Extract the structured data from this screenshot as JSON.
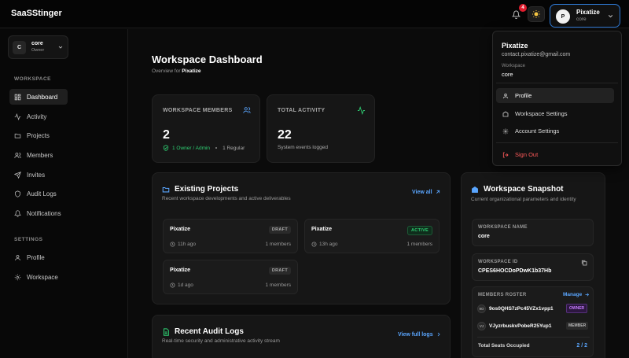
{
  "topbar": {
    "brand": "SaaSStinger",
    "notif_count": "4"
  },
  "user": {
    "name": "Pixatize",
    "workspace": "core",
    "avatar_initial": "P"
  },
  "sidebar": {
    "workspace": {
      "initial": "C",
      "name": "core",
      "role": "Owner"
    },
    "section_workspace": "WORKSPACE",
    "section_settings": "SETTINGS",
    "workspace_items": [
      {
        "label": "Dashboard",
        "icon": "dashboard-icon"
      },
      {
        "label": "Activity",
        "icon": "activity-icon"
      },
      {
        "label": "Projects",
        "icon": "folder-icon"
      },
      {
        "label": "Members",
        "icon": "users-icon"
      },
      {
        "label": "Invites",
        "icon": "invite-icon"
      },
      {
        "label": "Audit Logs",
        "icon": "shield-icon"
      },
      {
        "label": "Notifications",
        "icon": "bell-icon"
      }
    ],
    "settings_items": [
      {
        "label": "Profile",
        "icon": "user-icon"
      },
      {
        "label": "Workspace",
        "icon": "gear-icon"
      }
    ]
  },
  "main": {
    "title": "Workspace Dashboard",
    "subtitle_prefix": "Overview for",
    "subtitle_name": "Pixatize",
    "stats": {
      "members": {
        "label": "WORKSPACE MEMBERS",
        "value": "2",
        "owner_text": "1 Owner / Admin",
        "regular_text": "1 Regular"
      },
      "activity": {
        "label": "TOTAL ACTIVITY",
        "value": "22",
        "meta": "System events logged"
      }
    },
    "projects": {
      "title": "Existing Projects",
      "desc": "Recent workspace developments and active deliverables",
      "view_all": "View all",
      "items": [
        {
          "name": "Pixatize",
          "status": "DRAFT",
          "time": "11h ago",
          "members": "1 members"
        },
        {
          "name": "Pixatize",
          "status": "ACTIVE",
          "time": "13h ago",
          "members": "1 members"
        },
        {
          "name": "Pixatize",
          "status": "DRAFT",
          "time": "1d ago",
          "members": "1 members"
        }
      ]
    },
    "audit": {
      "title": "Recent Audit Logs",
      "desc": "Real-time security and administrative activity stream",
      "view_full": "View full logs"
    },
    "snapshot": {
      "title": "Workspace Snapshot",
      "desc": "Current organizational parameters and identity",
      "name_label": "WORKSPACE NAME",
      "name_value": "core",
      "id_label": "WORKSPACE ID",
      "id_value": "CPES6HOCDoPDwK1b37Hb",
      "roster_label": "MEMBERS ROSTER",
      "manage": "Manage",
      "roster": [
        {
          "initials": "9O",
          "id": "9os0QHS7zPc45VZx1vpp1",
          "role": "OWNER"
        },
        {
          "initials": "VJ",
          "id": "VJyzrbuskvPobeR25Yup1",
          "role": "MEMBER"
        }
      ],
      "seats_label": "Total Seats Occupied",
      "seats_value": "2 / 2"
    }
  },
  "dropdown": {
    "name": "Pixatize",
    "email": "contact.pixatize@gmail.com",
    "workspace_label": "Workspace",
    "workspace": "core",
    "items": [
      {
        "label": "Profile"
      },
      {
        "label": "Workspace Settings"
      },
      {
        "label": "Account Settings"
      }
    ],
    "signout": "Sign Out"
  },
  "colors": {
    "accent": "#2f7bd8",
    "link": "#5aa6ff",
    "success": "#2ecc71",
    "danger": "#ff5a5a",
    "badge": "#e11d2e"
  }
}
